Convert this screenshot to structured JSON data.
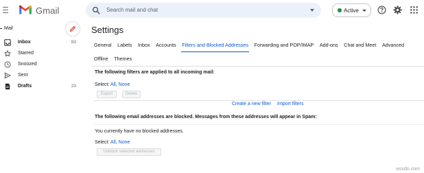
{
  "brand": {
    "name": "Gmail"
  },
  "search": {
    "placeholder": "Search mail and chat"
  },
  "status": {
    "label": "Active",
    "color": "#1e8e3e"
  },
  "sidebar": {
    "section": "Mail",
    "items": [
      {
        "label": "Inbox",
        "count": "83",
        "icon": "inbox-icon",
        "bold": true
      },
      {
        "label": "Starred",
        "count": "",
        "icon": "star-icon",
        "bold": false
      },
      {
        "label": "Snoozed",
        "count": "",
        "icon": "clock-icon",
        "bold": false
      },
      {
        "label": "Sent",
        "count": "",
        "icon": "send-icon",
        "bold": false
      },
      {
        "label": "Drafts",
        "count": "23",
        "icon": "draft-icon",
        "bold": true
      }
    ]
  },
  "settings": {
    "title": "Settings",
    "tabs_row1": [
      "General",
      "Labels",
      "Inbox",
      "Accounts",
      "Filters and Blocked Addresses",
      "Forwarding and POP/IMAP",
      "Add-ons",
      "Chat and Meet",
      "Advanced"
    ],
    "tabs_row2": [
      "Offline",
      "Themes"
    ],
    "active_tab": "Filters and Blocked Addresses",
    "filters": {
      "heading": "The following filters are applied to all incoming mail:",
      "select_prefix": "Select:",
      "select_all": "All",
      "select_sep": ",",
      "select_none": "None",
      "export_label": "Export",
      "delete_label": "Delete",
      "create_link": "Create a new filter",
      "import_link": "Import filters"
    },
    "blocked": {
      "heading": "The following email addresses are blocked. Messages from these addresses will appear in Spam:",
      "empty_text": "You currently have no blocked addresses.",
      "select_prefix": "Select:",
      "select_all": "All",
      "select_sep": ",",
      "select_none": "None",
      "unblock_label": "Unblock selected addresses"
    }
  },
  "watermark": "wsxdn.com",
  "colors": {
    "accent": "#0b57d0",
    "search_bg": "#eaf1fb",
    "gmail_red": "#ea4335"
  }
}
